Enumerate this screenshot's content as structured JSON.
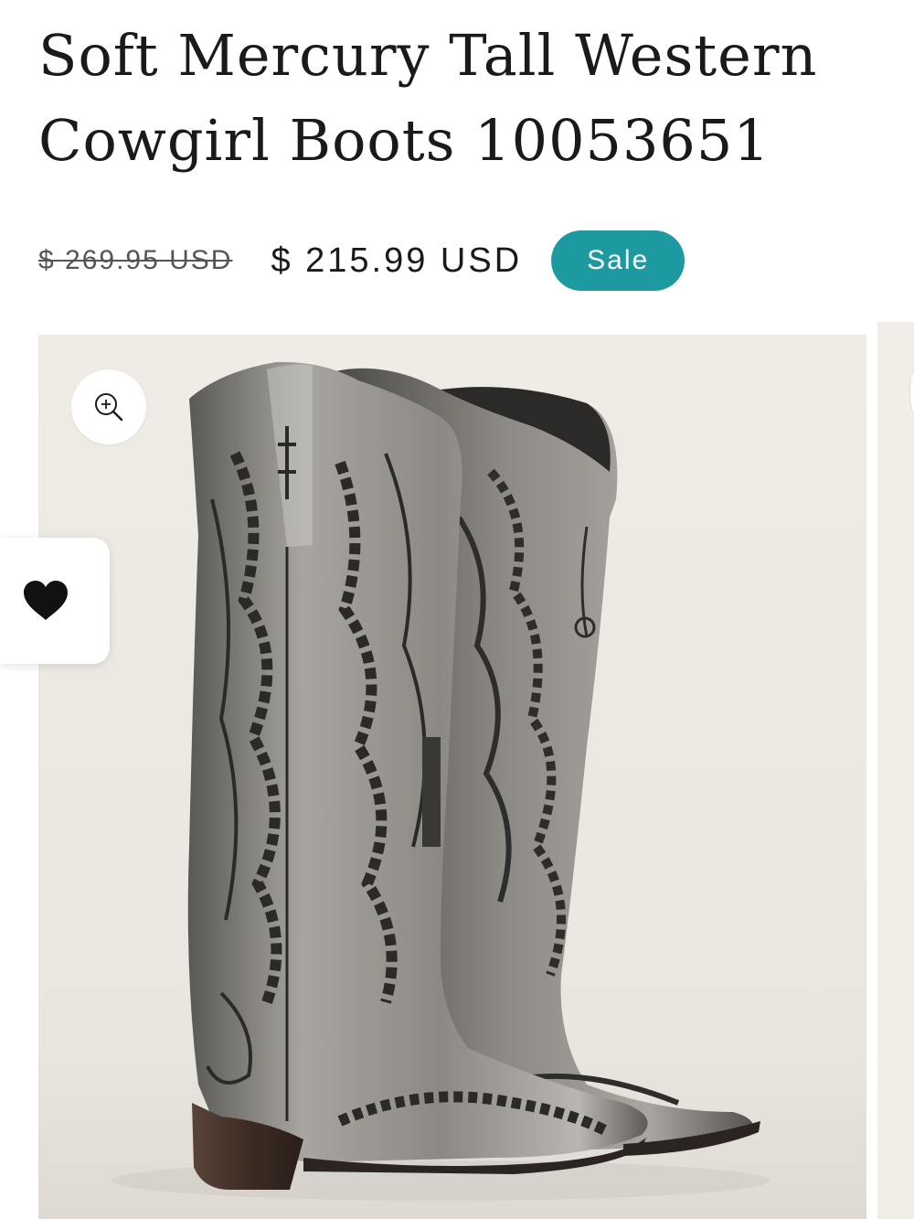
{
  "product": {
    "title": "Soft Mercury Tall Western Cowgirl Boots 10053651",
    "price_original": "$ 269.95 USD",
    "price_sale": "$ 215.99 USD",
    "badge": "Sale"
  },
  "gallery": {
    "image_alt": "Pair of metallic silver tall western cowgirl boots with dark embroidered stitching",
    "zoom_icon": "zoom-in-icon",
    "wishlist_icon": "heart-icon"
  },
  "colors": {
    "sale_badge": "#1c9aa0",
    "text": "#1a1a1a",
    "photo_background": "#efece5"
  }
}
